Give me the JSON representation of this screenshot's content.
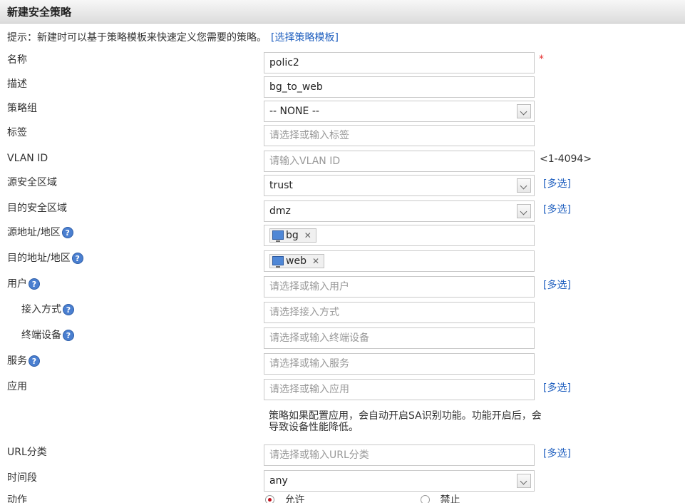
{
  "window": {
    "title": "新建安全策略"
  },
  "hint": {
    "text": "提示：新建时可以基于策略模板来快速定义您需要的策略。",
    "link": "[选择策略模板]"
  },
  "fields": {
    "name": {
      "label": "名称",
      "value": "polic2",
      "required_mark": "*"
    },
    "description": {
      "label": "描述",
      "value": "bg_to_web"
    },
    "policy_group": {
      "label": "策略组",
      "value": "-- NONE --"
    },
    "tag": {
      "label": "标签",
      "placeholder": "请选择或输入标签"
    },
    "vlan": {
      "label": "VLAN ID",
      "placeholder": "请输入VLAN ID",
      "range": "<1-4094>"
    },
    "src_zone": {
      "label": "源安全区域",
      "value": "trust",
      "multi": "[多选]"
    },
    "dst_zone": {
      "label": "目的安全区域",
      "value": "dmz",
      "multi": "[多选]"
    },
    "src_addr": {
      "label": "源地址/地区",
      "tag": "bg"
    },
    "dst_addr": {
      "label": "目的地址/地区",
      "tag": "web"
    },
    "user": {
      "label": "用户",
      "placeholder": "请选择或输入用户",
      "multi": "[多选]"
    },
    "access_mode": {
      "label": "接入方式",
      "placeholder": "请选择接入方式"
    },
    "terminal": {
      "label": "终端设备",
      "placeholder": "请选择或输入终端设备"
    },
    "service": {
      "label": "服务",
      "placeholder": "请选择或输入服务"
    },
    "application": {
      "label": "应用",
      "placeholder": "请选择或输入应用",
      "multi": "[多选]"
    },
    "app_note": "策略如果配置应用，会自动开启SA识别功能。功能开启后，会导致设备性能降低。",
    "url_category": {
      "label": "URL分类",
      "placeholder": "请选择或输入URL分类",
      "multi": "[多选]"
    },
    "time_range": {
      "label": "时间段",
      "value": "any"
    },
    "action": {
      "label": "动作",
      "options": [
        "允许",
        "禁止"
      ],
      "selected": "允许"
    }
  },
  "icons": {
    "help": "question-mark-icon",
    "address": "monitor-icon",
    "remove": "close-icon"
  },
  "colors": {
    "link": "#1f5fbf",
    "required": "#e53333",
    "help": "#4a7fd0",
    "radio_selected": "#c0141f"
  }
}
